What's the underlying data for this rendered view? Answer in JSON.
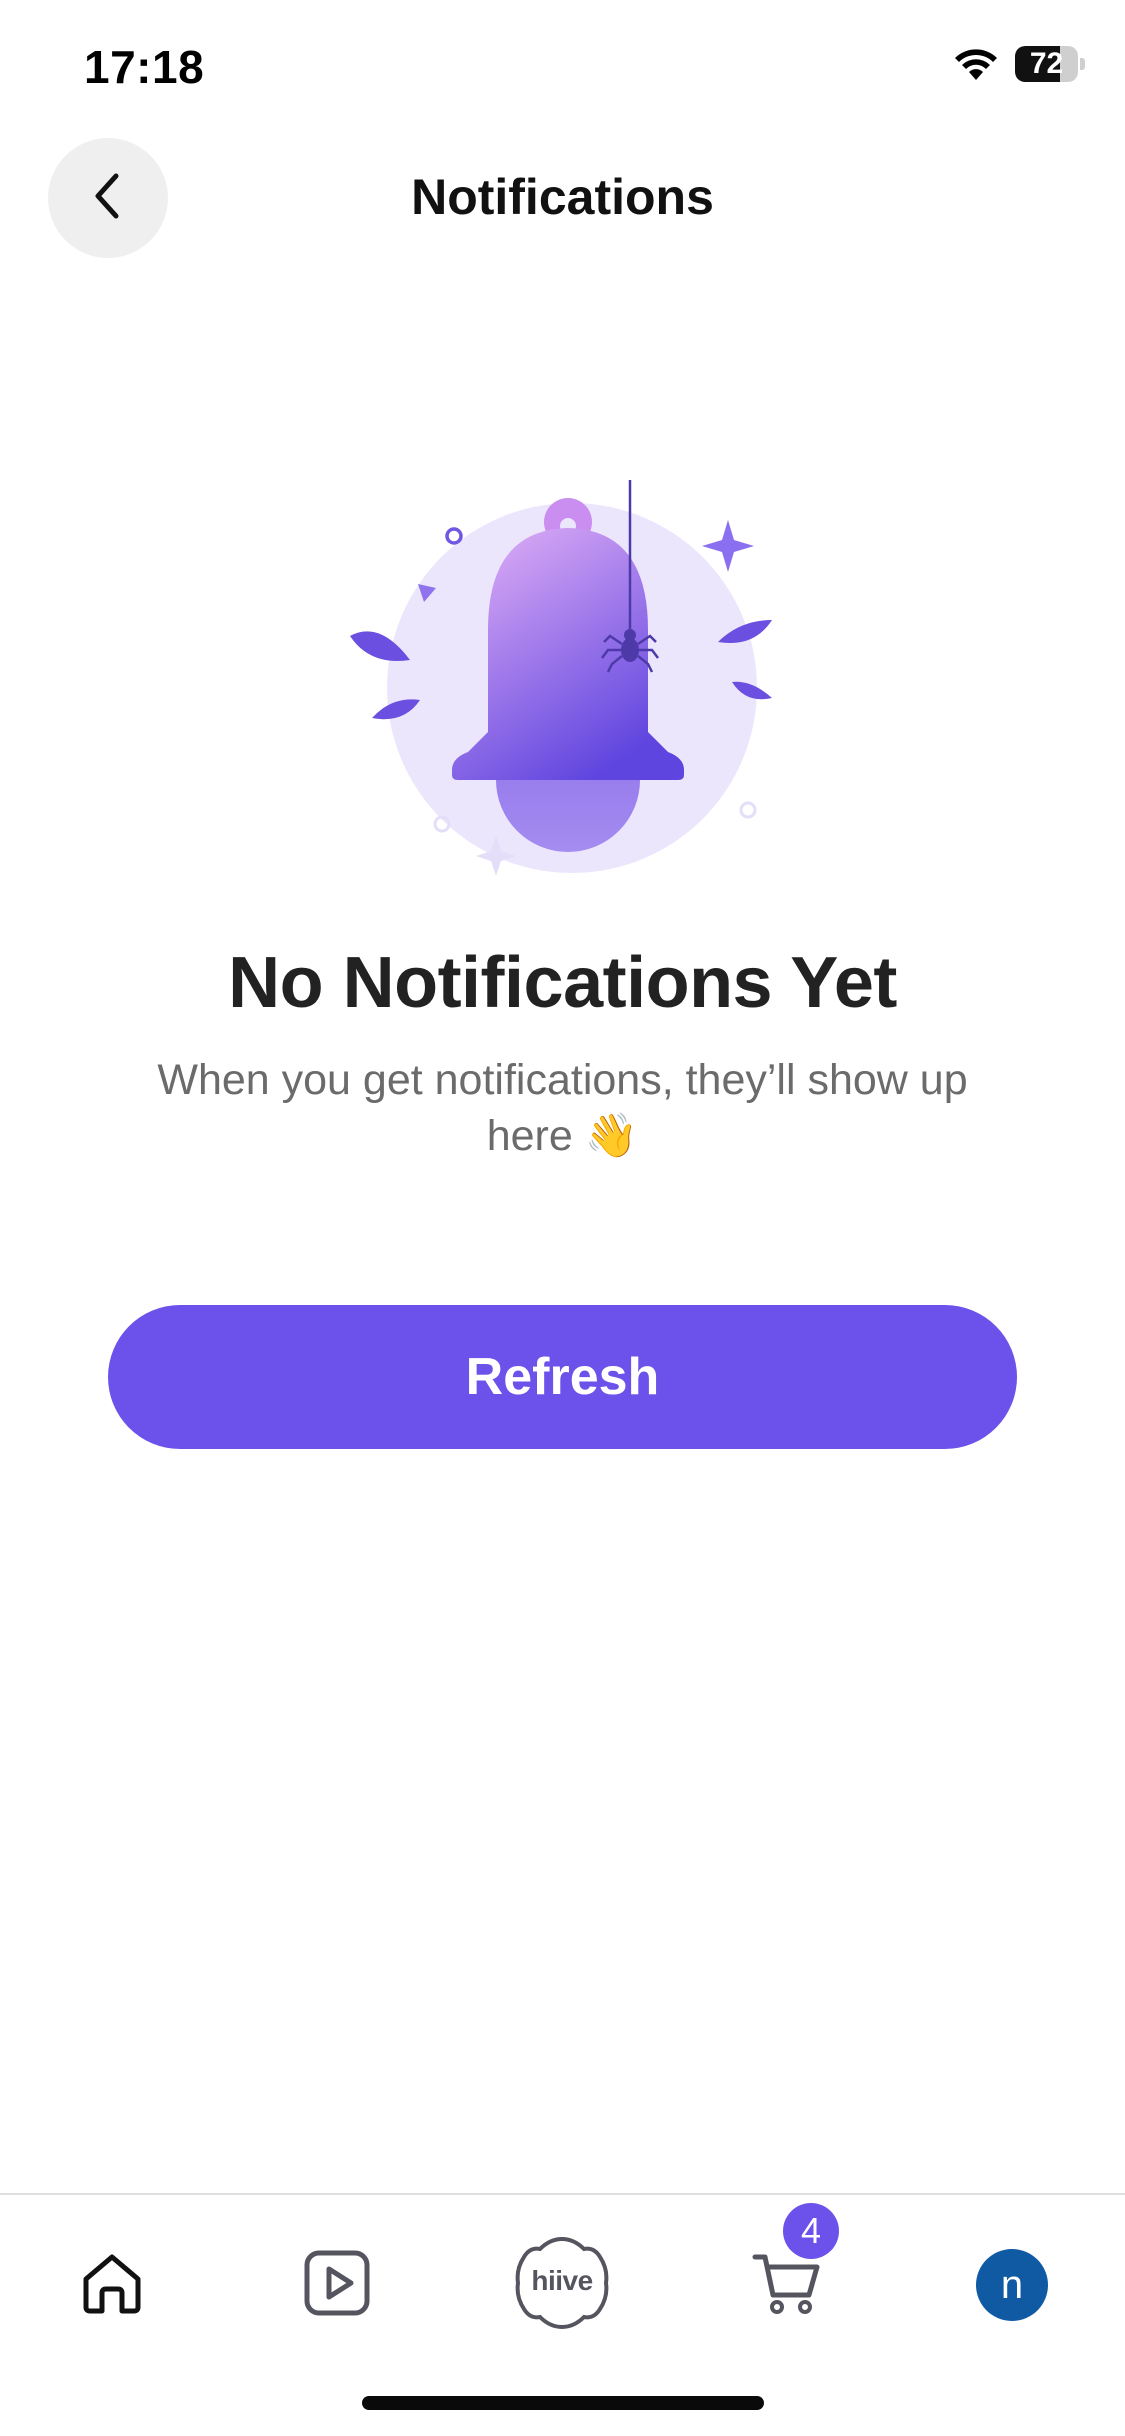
{
  "status_bar": {
    "time": "17:18",
    "battery_level": "72",
    "battery_fraction": 0.72,
    "icons": [
      "wifi-icon",
      "battery-icon"
    ]
  },
  "header": {
    "title": "Notifications",
    "back_icon": "chevron-left-icon"
  },
  "empty_state": {
    "illustration": "bell-with-spider-illustration",
    "title": "No Notifications Yet",
    "subtitle": "When you get notifications, they’ll show up here 👋"
  },
  "actions": {
    "refresh_label": "Refresh"
  },
  "tab_bar": {
    "items": [
      {
        "icon": "home-icon"
      },
      {
        "icon": "play-icon"
      },
      {
        "icon": "hiive-logo-icon",
        "label": "hiive"
      },
      {
        "icon": "cart-icon",
        "badge": "4"
      },
      {
        "icon": "avatar",
        "initial": "n"
      }
    ]
  },
  "colors": {
    "accent": "#6c52ea",
    "avatar_bg": "#0f5aa3",
    "title_text": "#222222",
    "subtitle_text": "#6b6b6b"
  }
}
